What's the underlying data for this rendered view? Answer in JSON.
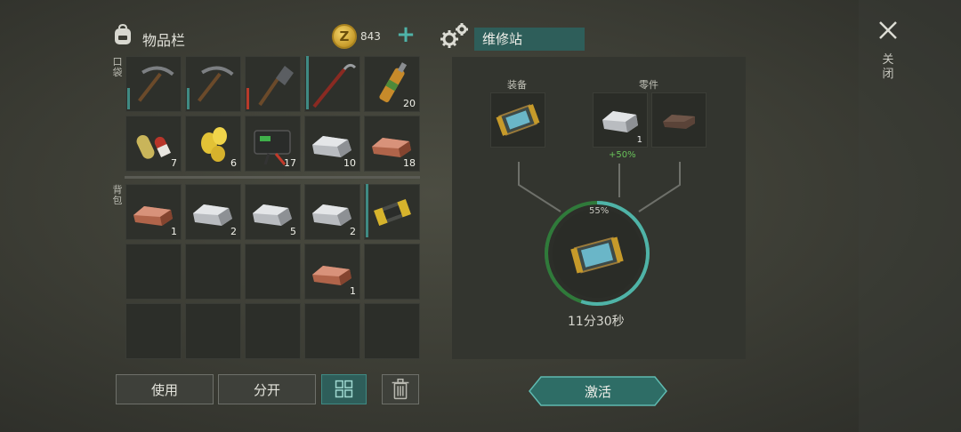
{
  "inventory": {
    "title": "物品栏",
    "coins": "843",
    "coin_symbol": "Z",
    "pockets_label": "口袋",
    "backpack_label": "背包",
    "pockets": [
      {
        "icon": "pickaxe-icon",
        "count": ""
      },
      {
        "icon": "pickaxe-icon",
        "count": ""
      },
      {
        "icon": "shovel-icon",
        "count": ""
      },
      {
        "icon": "crowbar-icon",
        "count": ""
      },
      {
        "icon": "bottle-icon",
        "count": "20"
      },
      {
        "icon": "pills-icon",
        "count": "7"
      },
      {
        "icon": "corn-icon",
        "count": "6"
      },
      {
        "icon": "battery-icon",
        "count": "17"
      },
      {
        "icon": "iron-ingot-icon",
        "count": "10"
      },
      {
        "icon": "copper-ingot-icon",
        "count": "18"
      }
    ],
    "backpack": [
      {
        "icon": "copper-ingot-icon",
        "count": "1"
      },
      {
        "icon": "iron-ingot-icon",
        "count": "2"
      },
      {
        "icon": "iron-ingot-icon",
        "count": "5"
      },
      {
        "icon": "iron-ingot-icon",
        "count": "2"
      },
      {
        "icon": "toolbox-icon",
        "count": ""
      },
      {
        "icon": "",
        "count": ""
      },
      {
        "icon": "",
        "count": ""
      },
      {
        "icon": "",
        "count": ""
      },
      {
        "icon": "copper-ingot-icon",
        "count": "1"
      },
      {
        "icon": "",
        "count": ""
      },
      {
        "icon": "",
        "count": ""
      },
      {
        "icon": "",
        "count": ""
      },
      {
        "icon": "",
        "count": ""
      },
      {
        "icon": "",
        "count": ""
      },
      {
        "icon": "",
        "count": ""
      }
    ],
    "buttons": {
      "use": "使用",
      "split": "分开"
    }
  },
  "repair": {
    "title": "维修站",
    "equipment_label": "装备",
    "parts_label": "零件",
    "part_count": "1",
    "bonus": "+50%",
    "progress_text": "55%",
    "progress_value": 0.55,
    "timer": "11分30秒",
    "activate": "激活"
  },
  "close": {
    "label": "关闭"
  },
  "colors": {
    "accent": "#2e5e5a",
    "progress": "#4fb3a8",
    "bonus": "#69c25a"
  }
}
